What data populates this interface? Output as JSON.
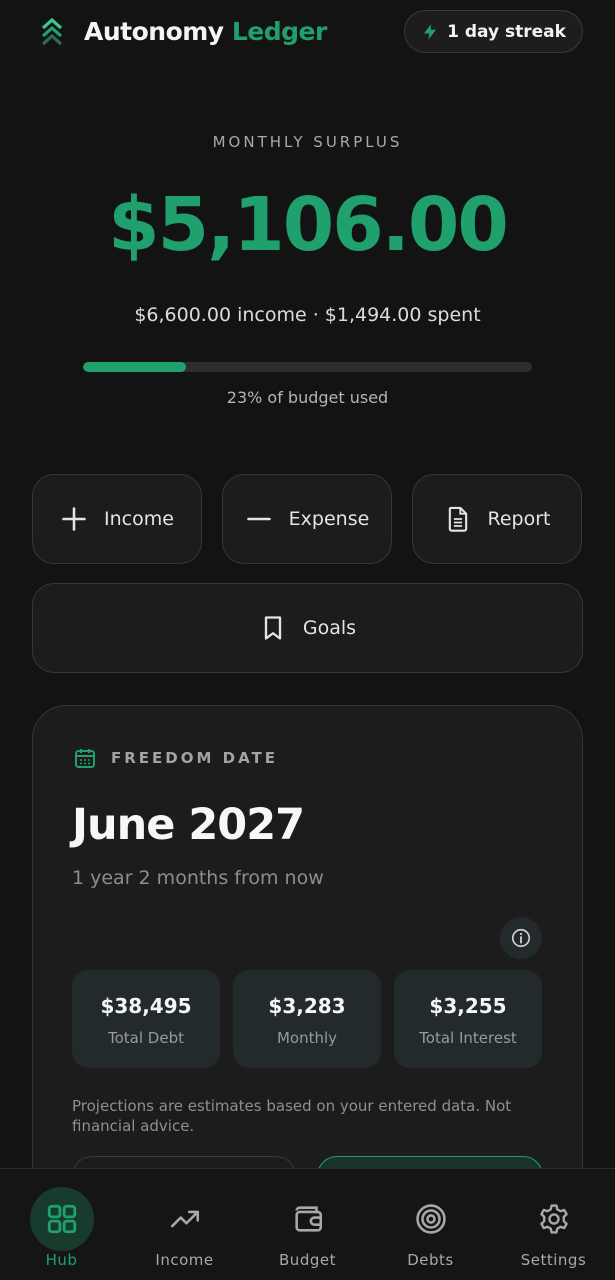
{
  "colors": {
    "accent": "#1fa06c",
    "background": "#131313",
    "card": "#1c1c1d",
    "stat_tile": "#222a2b"
  },
  "header": {
    "app_name_part1": "Autonomy",
    "app_name_part2": "Ledger",
    "logo_icon": "chevrons-up-icon",
    "streak": {
      "icon": "lightning-icon",
      "label": "1 day streak"
    }
  },
  "summary": {
    "label": "MONTHLY SURPLUS",
    "amount": "$5,106.00",
    "subtitle": "$6,600.00 income · $1,494.00 spent",
    "budget_used_fraction": 0.23,
    "budget_used_text": "23% of budget used"
  },
  "actions": {
    "income": {
      "label": "Income",
      "icon": "plus-icon"
    },
    "expense": {
      "label": "Expense",
      "icon": "minus-icon"
    },
    "report": {
      "label": "Report",
      "icon": "document-icon"
    },
    "goals": {
      "label": "Goals",
      "icon": "bookmark-icon"
    }
  },
  "freedom_card": {
    "heading": "FREEDOM DATE",
    "heading_icon": "calendar-icon",
    "date": "June 2027",
    "relative": "1 year 2 months from now",
    "info_icon": "info-icon",
    "stats": [
      {
        "value": "$38,495",
        "label": "Total Debt"
      },
      {
        "value": "$3,283",
        "label": "Monthly"
      },
      {
        "value": "$3,255",
        "label": "Total Interest"
      }
    ],
    "disclaimer": "Projections are estimates based on your entered data. Not financial advice."
  },
  "tabs": [
    {
      "label": "Hub",
      "icon": "grid-icon",
      "active": true
    },
    {
      "label": "Income",
      "icon": "trending-up-icon",
      "active": false
    },
    {
      "label": "Budget",
      "icon": "wallet-icon",
      "active": false
    },
    {
      "label": "Debts",
      "icon": "target-icon",
      "active": false
    },
    {
      "label": "Settings",
      "icon": "gear-icon",
      "active": false
    }
  ]
}
